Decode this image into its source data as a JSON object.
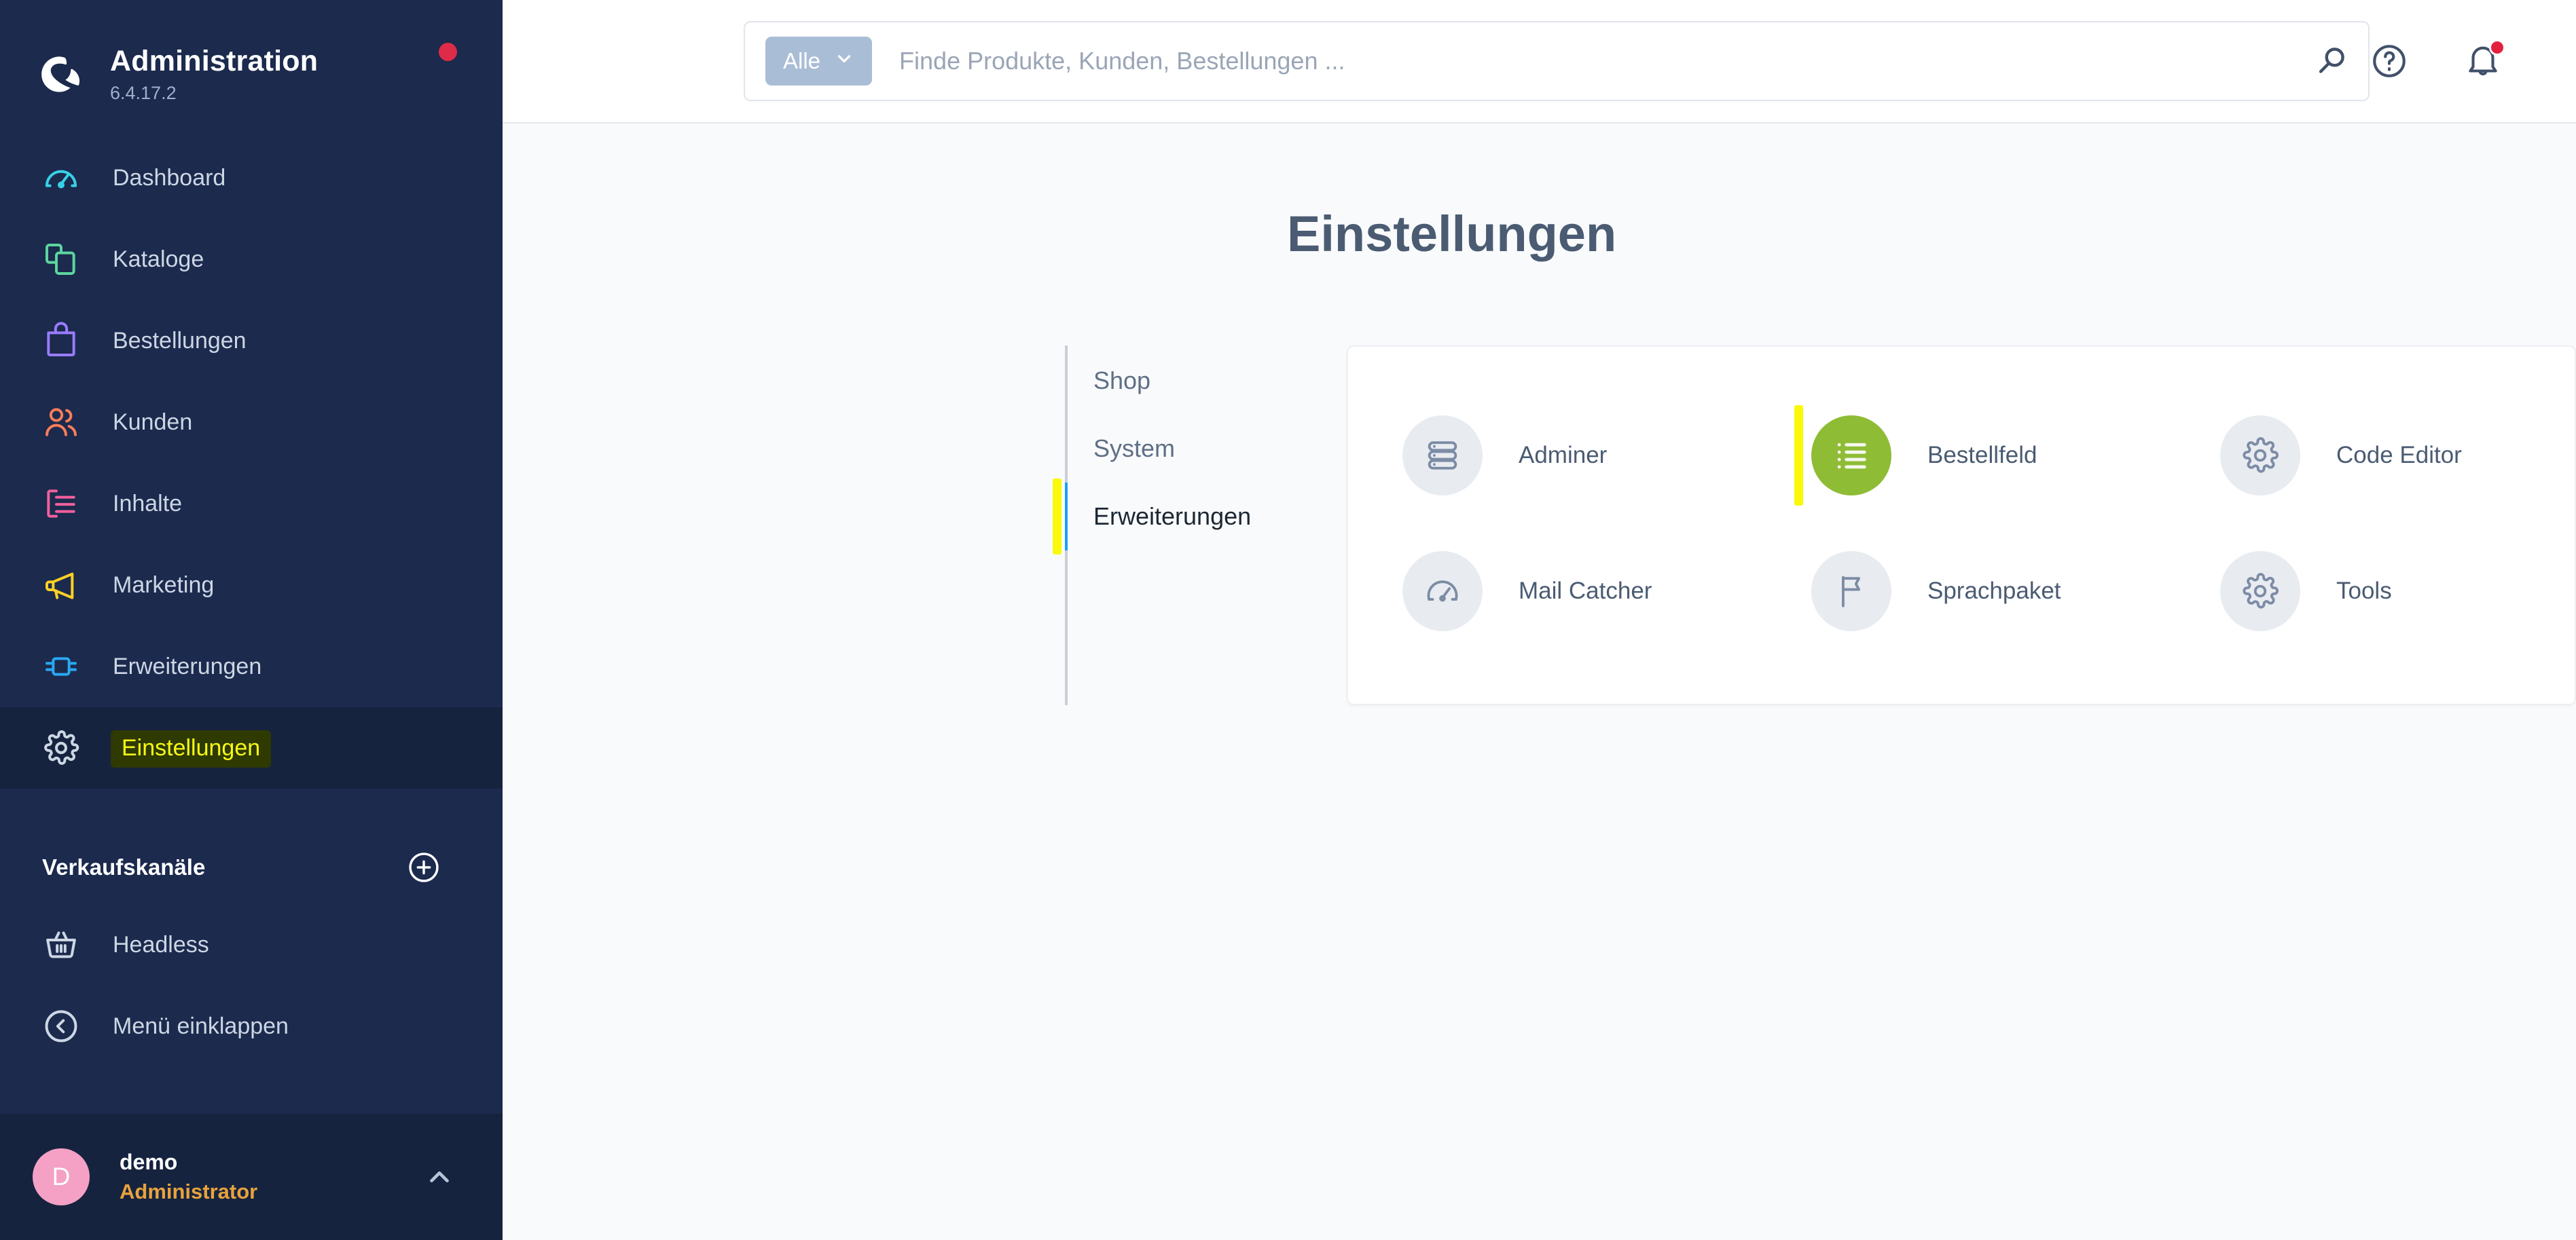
{
  "sidebar": {
    "brand": {
      "title": "Administration",
      "version": "6.4.17.2",
      "logo_icon": "shopware-logo-icon",
      "status_dot": "red-status-dot"
    },
    "items": [
      {
        "label": "Dashboard",
        "icon": "dashboard-gauge-icon",
        "color": "#37d1e8",
        "active": false
      },
      {
        "label": "Kataloge",
        "icon": "catalog-layers-icon",
        "color": "#5cd6a0",
        "active": false
      },
      {
        "label": "Bestellungen",
        "icon": "orders-bag-icon",
        "color": "#9a7bff",
        "active": false
      },
      {
        "label": "Kunden",
        "icon": "customers-people-icon",
        "color": "#f97d5a",
        "active": false
      },
      {
        "label": "Inhalte",
        "icon": "content-list-icon",
        "color": "#f3609c",
        "active": false
      },
      {
        "label": "Marketing",
        "icon": "marketing-megaphone-icon",
        "color": "#ffd024",
        "active": false
      },
      {
        "label": "Erweiterungen",
        "icon": "extensions-plug-icon",
        "color": "#2aa8f2",
        "active": false
      },
      {
        "label": "Einstellungen",
        "icon": "settings-gear-icon",
        "color": "#cdd6e4",
        "active": true,
        "highlighted": true
      }
    ],
    "sales_channels": {
      "title": "Verkaufskanäle",
      "add_icon": "plus-circle-icon"
    },
    "channels": [
      {
        "label": "Headless",
        "icon": "basket-icon"
      }
    ],
    "collapse": {
      "label": "Menü einklappen",
      "icon": "chevron-left-circle-icon"
    },
    "user": {
      "initial": "D",
      "name": "demo",
      "role": "Administrator",
      "chevron_icon": "chevron-up-icon",
      "avatar_color": "#f4a1c5"
    }
  },
  "topbar": {
    "search": {
      "scope_label": "Alle",
      "scope_chevron_icon": "chevron-down-icon",
      "placeholder": "Finde Produkte, Kunden, Bestellungen ...",
      "value": "",
      "submit_icon": "search-icon"
    },
    "help_icon": "question-circle-icon",
    "notifications_icon": "bell-icon",
    "notifications_badge": true
  },
  "page": {
    "title": "Einstellungen",
    "tabs": [
      {
        "label": "Shop",
        "active": false,
        "highlighted": false
      },
      {
        "label": "System",
        "active": false,
        "highlighted": false
      },
      {
        "label": "Erweiterungen",
        "active": true,
        "highlighted": true
      }
    ],
    "tiles": [
      {
        "label": "Adminer",
        "icon": "database-stack-icon",
        "accent": false,
        "highlighted": false
      },
      {
        "label": "Bestellfeld",
        "icon": "bulleted-list-icon",
        "accent": true,
        "highlighted": true
      },
      {
        "label": "Code Editor",
        "icon": "gear-icon",
        "accent": false,
        "highlighted": false
      },
      {
        "label": "Mail Catcher",
        "icon": "gauge-icon",
        "accent": false,
        "highlighted": false
      },
      {
        "label": "Sprachpaket",
        "icon": "flag-icon",
        "accent": false,
        "highlighted": false
      },
      {
        "label": "Tools",
        "icon": "gear-icon",
        "accent": false,
        "highlighted": false
      }
    ]
  },
  "colors": {
    "sidebar_bg": "#1b2a4d",
    "sidebar_active_bg": "#16233f",
    "content_bg": "#f9fafb",
    "accent_blue": "#189eff",
    "accent_green": "#8fbc35",
    "annotation_yellow": "#f9f909",
    "annotation_text": "#f7f718",
    "annotation_bg": "#2e3a00",
    "danger_red": "#de2c48",
    "role_orange": "#e8a33d"
  }
}
